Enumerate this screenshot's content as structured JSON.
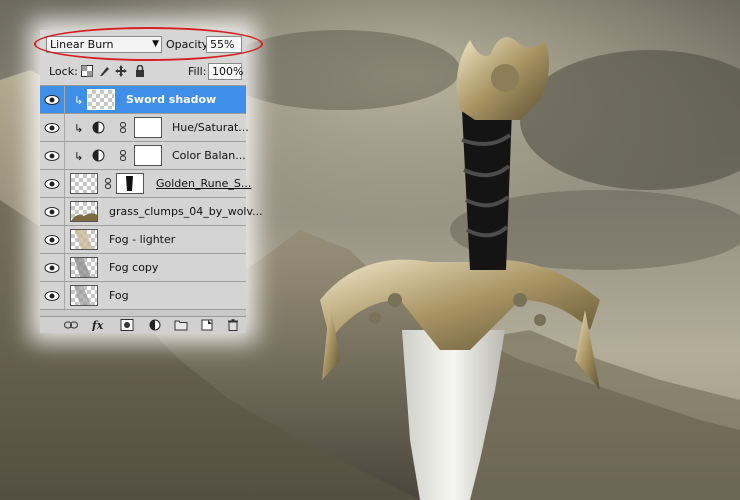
{
  "blend_mode": {
    "value": "Linear Burn",
    "options_visible": "Linear Burn"
  },
  "opacity": {
    "label": "Opacity:",
    "value": "55%"
  },
  "lock": {
    "label": "Lock:"
  },
  "fill": {
    "label": "Fill:",
    "value": "100%"
  },
  "layers": [
    {
      "name": "Sword shadow",
      "type": "pixel-clipped",
      "selected": true,
      "visible": true
    },
    {
      "name": "Hue/Saturat...",
      "type": "adjustment-clipped",
      "selected": false,
      "visible": true
    },
    {
      "name": "Color Balan...",
      "type": "adjustment-clipped",
      "selected": false,
      "visible": true
    },
    {
      "name": "Golden_Rune_S...",
      "type": "smart-object-masked",
      "selected": false,
      "visible": true
    },
    {
      "name": "grass_clumps_04_by_wolv...",
      "type": "smart-object",
      "selected": false,
      "visible": true
    },
    {
      "name": "Fog - lighter",
      "type": "pixel",
      "selected": false,
      "visible": true
    },
    {
      "name": "Fog copy",
      "type": "pixel",
      "selected": false,
      "visible": true
    },
    {
      "name": "Fog",
      "type": "pixel",
      "selected": false,
      "visible": true
    }
  ],
  "footer_icons": [
    "link-layers-icon",
    "fx-icon",
    "add-mask-icon",
    "adjustment-layer-icon",
    "new-group-icon",
    "new-layer-icon",
    "trash-icon"
  ],
  "colors": {
    "selection": "#3f8ee8",
    "highlight_ellipse": "#d42020",
    "panel": "#d6d6d6"
  }
}
